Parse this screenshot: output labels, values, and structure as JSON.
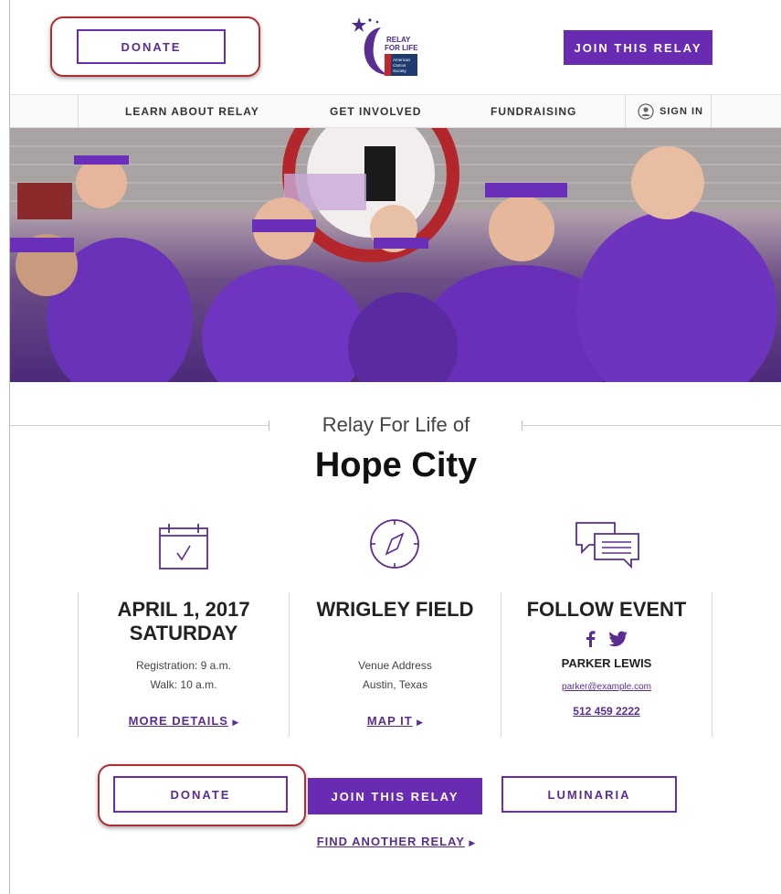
{
  "header": {
    "donate_label": "DONATE",
    "join_label": "JOIN THIS RELAY",
    "logo": {
      "line1": "RELAY",
      "line2": "FOR LIFE",
      "badge_line1": "American",
      "badge_line2": "Cancer",
      "badge_line3": "Society"
    }
  },
  "nav": {
    "items": [
      {
        "label": "LEARN ABOUT RELAY"
      },
      {
        "label": "GET INVOLVED"
      },
      {
        "label": "FUNDRAISING"
      },
      {
        "label": "SIGN IN"
      }
    ]
  },
  "event": {
    "subtitle": "Relay For Life of",
    "title": "Hope City"
  },
  "columns": {
    "date": {
      "line1": "APRIL 1, 2017",
      "line2": "SATURDAY",
      "registration": "Registration: 9 a.m.",
      "walk": "Walk: 10 a.m.",
      "link": "MORE DETAILS"
    },
    "venue": {
      "name": "WRIGLEY FIELD",
      "address": "Venue Address",
      "city": "Austin, Texas",
      "link": "MAP IT"
    },
    "follow": {
      "heading": "FOLLOW EVENT",
      "contact_name": "PARKER LEWIS",
      "email": "parker@example.com",
      "phone": "512 459 2222"
    }
  },
  "actions": {
    "donate_label": "DONATE",
    "join_label": "JOIN THIS RELAY",
    "luminaria_label": "LUMINARIA",
    "find_label": "FIND ANOTHER RELAY"
  },
  "colors": {
    "brand_purple": "#6a2bb3",
    "highlight_red": "#b02c33"
  },
  "icons": [
    "calendar-icon",
    "compass-icon",
    "chat-icon",
    "facebook-icon",
    "twitter-icon",
    "user-circle-icon",
    "arrow-right-icon"
  ]
}
